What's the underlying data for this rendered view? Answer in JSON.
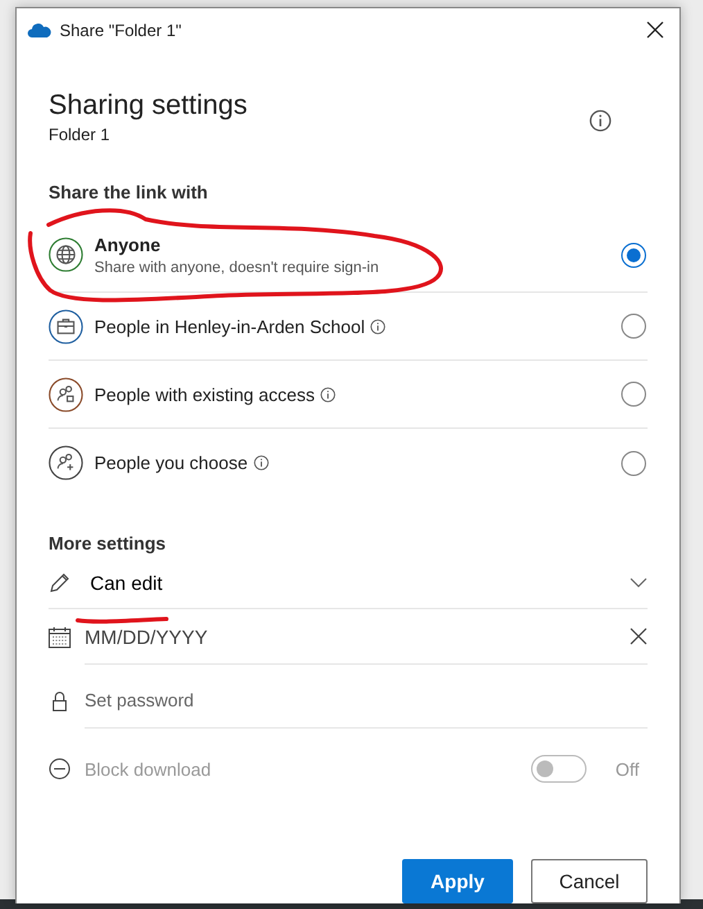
{
  "window": {
    "title": "Share \"Folder 1\""
  },
  "header": {
    "title": "Sharing settings",
    "subtitle": "Folder 1"
  },
  "share_section": {
    "heading": "Share the link with",
    "options": [
      {
        "kind": "globe",
        "label": "Anyone",
        "description": "Share with anyone, doesn't require sign-in",
        "info": false,
        "selected": true
      },
      {
        "kind": "organization",
        "label": "People in Henley-in-Arden School",
        "info": true,
        "selected": false
      },
      {
        "kind": "existing",
        "label": "People with existing access",
        "info": true,
        "selected": false
      },
      {
        "kind": "choose",
        "label": "People you choose",
        "info": true,
        "selected": false
      }
    ]
  },
  "more_settings": {
    "heading": "More settings",
    "permission": {
      "value": "Can edit"
    },
    "expiry": {
      "placeholder": "MM/DD/YYYY"
    },
    "password": {
      "placeholder": "Set password"
    },
    "block_download": {
      "label": "Block download",
      "on": false,
      "disabled": true,
      "state_text": "Off"
    }
  },
  "buttons": [
    {
      "kind": "primary",
      "label": "Apply"
    },
    {
      "kind": "secondary",
      "label": "Cancel"
    }
  ]
}
